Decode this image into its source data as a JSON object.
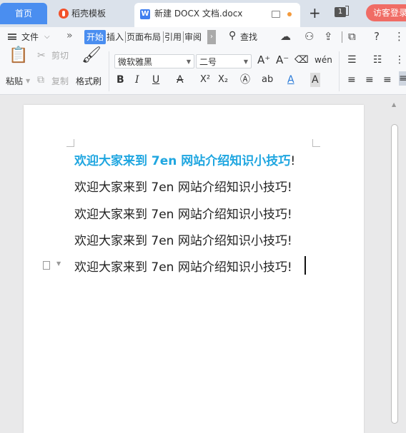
{
  "tabs": {
    "home": "首页",
    "template": "稻壳模板",
    "doc": "新建 DOCX 文档.docx",
    "doc_icon": "W",
    "add": "+",
    "count": "1",
    "login": "访客登录"
  },
  "menu": {
    "file": "文件",
    "more": "»",
    "start": "开始",
    "insert": "插入",
    "layout": "页面布局",
    "ref": "引用",
    "review": "审阅",
    "overflow": "›",
    "search": "查找"
  },
  "toolbar": {
    "paste": "粘贴",
    "cut": "剪切",
    "copy": "复制",
    "format_painter": "格式刷",
    "font_name": "微软雅黑",
    "font_size": "二号",
    "bold": "B",
    "italic": "I",
    "underline": "U",
    "strike": "A",
    "superscript": "X²",
    "subscript": "X₂",
    "font_color": "A",
    "grow_font": "A⁺",
    "shrink_font": "A⁻"
  },
  "document": {
    "lines": [
      {
        "text": "欢迎大家来到 7en 网站介绍知识小技巧",
        "end": "!",
        "highlight": true
      },
      {
        "text": "欢迎大家来到 7en 网站介绍知识小技巧",
        "end": "!",
        "highlight": false
      },
      {
        "text": "欢迎大家来到 7en 网站介绍知识小技巧",
        "end": "!",
        "highlight": false
      },
      {
        "text": "欢迎大家来到 7en 网站介绍知识小技巧",
        "end": "!",
        "highlight": false
      },
      {
        "text": "欢迎大家来到 7en 网站介绍知识小技巧",
        "end": "!",
        "highlight": false
      }
    ]
  },
  "colors": {
    "accent": "#4a8ef0",
    "highlight_text": "#1fa6e0",
    "login": "#f06c65"
  }
}
